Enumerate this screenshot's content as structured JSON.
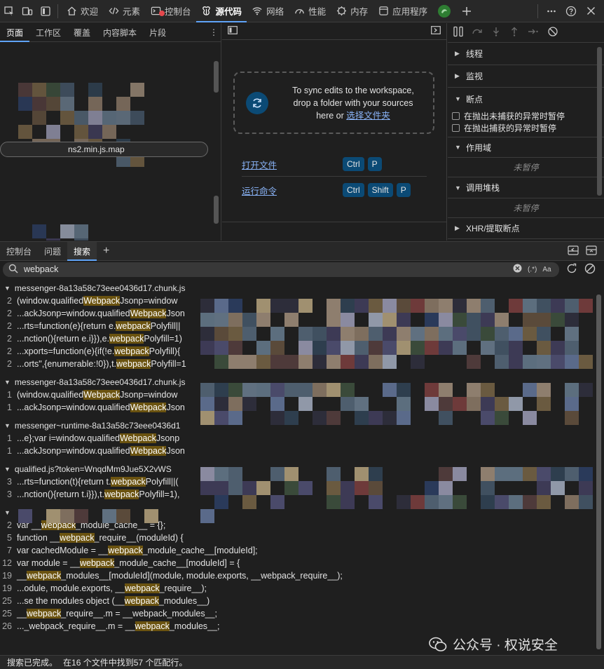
{
  "top_tabs": [
    {
      "label": "欢迎",
      "icon": "home-icon"
    },
    {
      "label": "元素",
      "icon": "elements-icon"
    },
    {
      "label": "控制台",
      "icon": "console-icon"
    },
    {
      "label": "源代码",
      "icon": "sources-icon"
    },
    {
      "label": "网络",
      "icon": "wifi-icon"
    },
    {
      "label": "性能",
      "icon": "performance-icon"
    },
    {
      "label": "内存",
      "icon": "memory-icon"
    },
    {
      "label": "应用程序",
      "icon": "application-icon"
    }
  ],
  "navigator": {
    "tabs": [
      "页面",
      "工作区",
      "覆盖",
      "内容脚本",
      "片段"
    ],
    "selected_file": "ns2.min.js.map"
  },
  "editor": {
    "sync_text_1": "To sync edits to the workspace,",
    "sync_text_2": "drop a folder with your sources",
    "sync_text_3": "here or",
    "sync_link": "选择文件夹",
    "open_file_label": "打开文件",
    "open_file_keys": [
      "Ctrl",
      "P"
    ],
    "run_command_label": "运行命令",
    "run_command_keys": [
      "Ctrl",
      "Shift",
      "P"
    ]
  },
  "debugger": {
    "sections": {
      "threads": "线程",
      "watch": "监视",
      "breakpoints": "断点",
      "scope": "作用域",
      "call_stack": "调用堆栈",
      "xhr": "XHR/提取断点"
    },
    "pause_uncaught": "在抛出未捕获的异常时暂停",
    "pause_caught": "在抛出捕获的异常时暂停",
    "not_paused": "未暂停"
  },
  "drawer": {
    "tabs": [
      "控制台",
      "问题",
      "搜索"
    ],
    "search_value": "webpack",
    "regex_label": "(.*)",
    "case_label": "Aa"
  },
  "results": {
    "files": [
      {
        "name": "messenger-8a13a58c73eee0436d17.chunk.js",
        "lines": [
          {
            "ln": "2",
            "pre": "(window.qualified",
            "hl": "Webpack",
            "post": "Jsonp=window"
          },
          {
            "ln": "2",
            "pre": "...ackJsonp=window.qualified",
            "hl": "Webpack",
            "post": "Json"
          },
          {
            "ln": "2",
            "pre": "...rts=function(e){return e.",
            "hl": "webpack",
            "post": "Polyfill||"
          },
          {
            "ln": "2",
            "pre": "...nction(){return e.i}}),e.",
            "hl": "webpack",
            "post": "Polyfill=1)"
          },
          {
            "ln": "2",
            "pre": "...xports=function(e){if(!e.",
            "hl": "webpack",
            "post": "Polyfill){"
          },
          {
            "ln": "2",
            "pre": "...orts\",{enumerable:!0}),t.",
            "hl": "webpack",
            "post": "Polyfill=1"
          }
        ]
      },
      {
        "name": "messenger-8a13a58c73eee0436d17.chunk.js",
        "lines": [
          {
            "ln": "1",
            "pre": "(window.qualified",
            "hl": "Webpack",
            "post": "Jsonp=window"
          },
          {
            "ln": "1",
            "pre": "...ackJsonp=window.qualified",
            "hl": "Webpack",
            "post": "Json"
          }
        ]
      },
      {
        "name": "messenger~runtime-8a13a58c73eee0436d1",
        "lines": [
          {
            "ln": "1",
            "pre": "...e};var i=window.qualified",
            "hl": "Webpack",
            "post": "Jsonp"
          },
          {
            "ln": "1",
            "pre": "...ackJsonp=window.qualified",
            "hl": "Webpack",
            "post": "Json"
          }
        ]
      },
      {
        "name": "qualified.js?token=WnqdMm9Jue5X2vWS",
        "lines": [
          {
            "ln": "3",
            "pre": "...rts=function(t){return t.",
            "hl": "webpack",
            "post": "Polyfill||("
          },
          {
            "ln": "3",
            "pre": "...nction(){return t.i}}),t.",
            "hl": "webpack",
            "post": "Polyfill=1),"
          }
        ]
      },
      {
        "name": "",
        "lines": [
          {
            "ln": "2",
            "pre": "var __",
            "hl": "webpack",
            "post": "_module_cache__ = {};"
          },
          {
            "ln": "5",
            "pre": "function __",
            "hl": "webpack",
            "post": "_require__(moduleId) {"
          },
          {
            "ln": "7",
            "pre": "var cachedModule = __",
            "hl": "webpack",
            "post": "_module_cache__[moduleId];"
          },
          {
            "ln": "12",
            "pre": "var module = __",
            "hl": "webpack",
            "post": "_module_cache__[moduleId] = {"
          },
          {
            "ln": "19",
            "pre": "__",
            "hl": "webpack",
            "post": "_modules__[moduleId](module, module.exports, __webpack_require__);"
          },
          {
            "ln": "19",
            "pre": "...odule, module.exports, __",
            "hl": "webpack",
            "post": "_require__);"
          },
          {
            "ln": "25",
            "pre": "...se the modules object (__",
            "hl": "webpack",
            "post": "_modules__)"
          },
          {
            "ln": "25",
            "pre": "__",
            "hl": "webpack",
            "post": "_require__.m = __webpack_modules__;"
          },
          {
            "ln": "26",
            "pre": "..._webpack_require__.m = __",
            "hl": "webpack",
            "post": "_modules__;"
          }
        ]
      }
    ]
  },
  "status": {
    "done": "搜索已完成。",
    "summary": "在16 个文件中找到57 个匹配行。"
  },
  "watermark": "公众号 · 权说安全",
  "colors": {
    "accent": "#5fa3f7",
    "highlight": "#6b5310",
    "link": "#8ab4f8",
    "kbd": "#0b4a75"
  }
}
